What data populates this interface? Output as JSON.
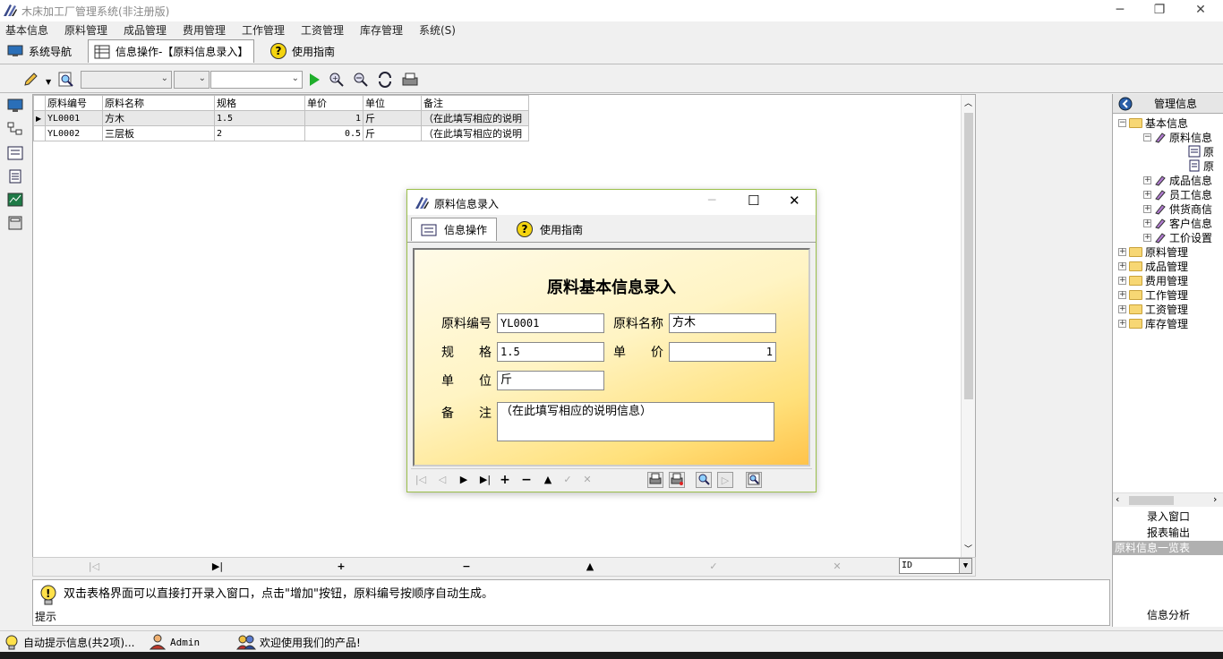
{
  "window": {
    "title": "木床加工厂管理系统(非注册版)",
    "minimize": "─",
    "restore": "❐",
    "close": "✕"
  },
  "menu": [
    "基本信息",
    "原料管理",
    "成品管理",
    "费用管理",
    "工作管理",
    "工资管理",
    "库存管理",
    "系统(S)"
  ],
  "tabs": [
    {
      "label": "系统导航",
      "icon": "monitor-icon"
    },
    {
      "label": "信息操作-【原料信息录入】",
      "icon": "grid-icon"
    },
    {
      "label": "使用指南",
      "icon": "help-icon"
    }
  ],
  "grid": {
    "columns": [
      "原料编号",
      "原料名称",
      "规格",
      "单价",
      "单位",
      "备注"
    ],
    "rows": [
      [
        "YL0001",
        "方木",
        "1.5",
        "1",
        "斤",
        "（在此填写相应的说明"
      ],
      [
        "YL0002",
        "三层板",
        "2",
        "0.5",
        "斤",
        "（在此填写相应的说明"
      ]
    ]
  },
  "navbar": {
    "first": "|◁",
    "last": "▶|",
    "add": "+",
    "delete": "−",
    "up": "▲",
    "post": "✓",
    "cancel": "✕",
    "sort_field": "ID"
  },
  "hint": {
    "text": "双击表格界面可以直接打开录入窗口，点击\"增加\"按钮，原料编号按顺序自动生成。",
    "label": "提示"
  },
  "right_panel": {
    "title": "管理信息",
    "tree": [
      {
        "label": "基本信息"
      },
      {
        "label": "原料信息"
      },
      {
        "label": "原"
      },
      {
        "label": "原"
      },
      {
        "label": "成品信息"
      },
      {
        "label": "员工信息"
      },
      {
        "label": "供货商信"
      },
      {
        "label": "客户信息"
      },
      {
        "label": "工价设置"
      },
      {
        "label": "原料管理"
      },
      {
        "label": "成品管理"
      },
      {
        "label": "费用管理"
      },
      {
        "label": "工作管理"
      },
      {
        "label": "工资管理"
      },
      {
        "label": "库存管理"
      }
    ],
    "btn_entry": "录入窗口",
    "btn_report": "报表输出",
    "selected": "原料信息一览表",
    "btn_analysis": "信息分析"
  },
  "status": {
    "auto_hint": "自动提示信息(共2项)...",
    "user": "Admin",
    "welcome": "欢迎使用我们的产品!"
  },
  "dialog": {
    "title": "原料信息录入",
    "tab_ops": "信息操作",
    "tab_guide": "使用指南",
    "form_title": "原料基本信息录入",
    "labels": {
      "code": "原料编号",
      "name": "原料名称",
      "spec": "规　　格",
      "price": "单　　价",
      "unit": "单　　位",
      "note": "备　　注"
    },
    "values": {
      "code": "YL0001",
      "name": "方木",
      "spec": "1.5",
      "price": "1",
      "unit": "斤",
      "note": "（在此填写相应的说明信息）"
    }
  },
  "colors": {
    "dialog_border": "#9bbf4a",
    "form_gradient_end": "#ffc34a",
    "selected_bg": "#b0b0b0"
  }
}
